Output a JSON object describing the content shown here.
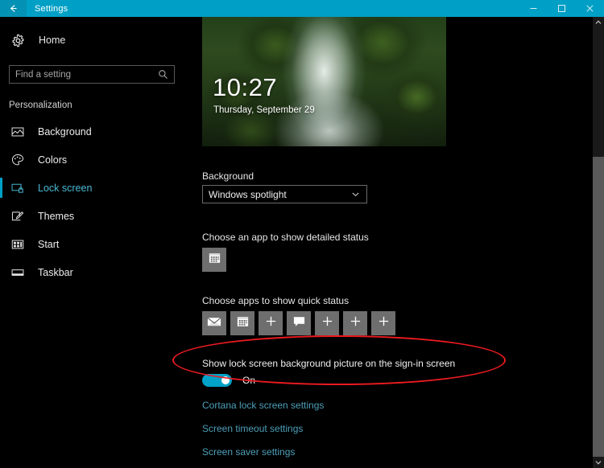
{
  "window": {
    "title": "Settings",
    "back_icon": "back-arrow-icon",
    "controls": {
      "minimize": "minimize-icon",
      "maximize": "maximize-icon",
      "close": "close-icon"
    },
    "titlebar_color": "#00a0c6"
  },
  "sidebar": {
    "home": {
      "label": "Home",
      "icon": "gear-icon"
    },
    "search": {
      "value": "",
      "placeholder": "Find a setting",
      "icon": "search-icon"
    },
    "group_header": "Personalization",
    "items": [
      {
        "label": "Background",
        "icon": "picture-icon",
        "selected": false
      },
      {
        "label": "Colors",
        "icon": "palette-icon",
        "selected": false
      },
      {
        "label": "Lock screen",
        "icon": "lock-screen-icon",
        "selected": true
      },
      {
        "label": "Themes",
        "icon": "themes-brush-icon",
        "selected": false
      },
      {
        "label": "Start",
        "icon": "start-tiles-icon",
        "selected": false
      },
      {
        "label": "Taskbar",
        "icon": "taskbar-icon",
        "selected": false
      }
    ],
    "accent_color": "#00a0c6",
    "selected_text_color": "#49b9d4"
  },
  "main": {
    "preview": {
      "name": "lock-screen-preview",
      "time": "10:27",
      "date": "Thursday, September 29",
      "scene": "waterfall-forest-photo"
    },
    "background_section": {
      "label": "Background",
      "dropdown_value": "Windows spotlight",
      "dropdown_icon": "chevron-down-icon"
    },
    "detailed_status": {
      "label": "Choose an app to show detailed status",
      "tile_icon": "calendar-icon"
    },
    "quick_status": {
      "label": "Choose apps to show quick status",
      "tiles": [
        {
          "icon": "mail-icon"
        },
        {
          "icon": "calendar-icon"
        },
        {
          "icon": "plus-icon"
        },
        {
          "icon": "message-icon"
        },
        {
          "icon": "plus-icon"
        },
        {
          "icon": "plus-icon"
        },
        {
          "icon": "plus-icon"
        }
      ]
    },
    "signin_toggle": {
      "label": "Show lock screen background picture on the sign-in screen",
      "state": "On",
      "on_color": "#00a2c7"
    },
    "links": [
      {
        "label": "Cortana lock screen settings"
      },
      {
        "label": "Screen timeout settings"
      },
      {
        "label": "Screen saver settings"
      }
    ],
    "link_color": "#4d9fb8"
  },
  "scrollbar": {
    "up_icon": "scroll-up-arrow-icon",
    "down_icon": "scroll-down-arrow-icon"
  },
  "annotation": {
    "shape": "red-ellipse-highlight",
    "color": "#ee1b20",
    "targets": "signin-toggle-setting"
  }
}
